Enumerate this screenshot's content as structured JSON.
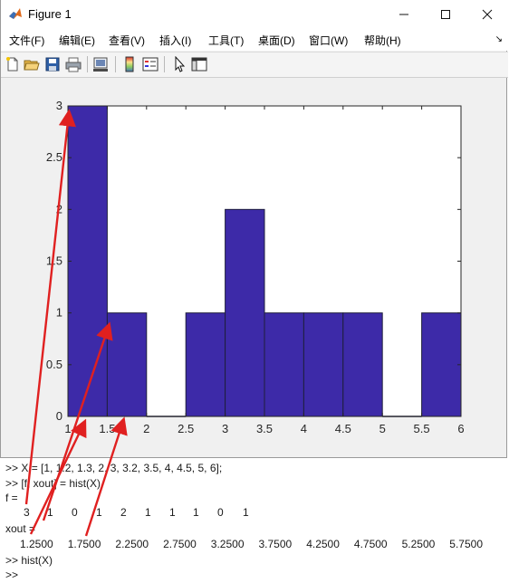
{
  "window": {
    "title": "Figure 1",
    "minimize_icon": "minimize-icon",
    "maximize_icon": "maximize-icon",
    "close_icon": "close-icon"
  },
  "menu": {
    "items": [
      "文件(F)",
      "编辑(E)",
      "查看(V)",
      "插入(I)",
      "工具(T)",
      "桌面(D)",
      "窗口(W)",
      "帮助(H)"
    ]
  },
  "toolbar": {
    "icons": [
      "new-figure-icon",
      "open-file-icon",
      "save-icon",
      "print-icon",
      "link-axes-icon",
      "colorbar-icon",
      "legend-icon",
      "pointer-icon",
      "property-editor-icon"
    ]
  },
  "chart_data": {
    "type": "bar",
    "style": "histogram",
    "bin_edges": [
      1,
      1.5,
      2,
      2.5,
      3,
      3.5,
      4,
      4.5,
      5,
      5.5,
      6
    ],
    "values": [
      3,
      1,
      0,
      1,
      2,
      1,
      1,
      1,
      0,
      1
    ],
    "xlim": [
      1,
      6
    ],
    "ylim": [
      0,
      3
    ],
    "xticks": [
      "1",
      "1.5",
      "2",
      "2.5",
      "3",
      "3.5",
      "4",
      "4.5",
      "5",
      "5.5",
      "6"
    ],
    "yticks": [
      "0",
      "0.5",
      "1",
      "1.5",
      "2",
      "2.5",
      "3"
    ],
    "bar_color": "#3d2aa8",
    "edge_color": "#1e1e3c",
    "grid": false
  },
  "console": {
    "cmd1": ">> X = [1, 1.2, 1.3, 2, 3, 3.2, 3.5, 4, 4.5, 5, 6];",
    "cmd2": ">> [f, xout] = hist(X)",
    "f_label": "f =",
    "f_values": [
      "3",
      "1",
      "0",
      "1",
      "2",
      "1",
      "1",
      "1",
      "0",
      "1"
    ],
    "xout_label": "xout =",
    "xout_values": [
      "1.2500",
      "1.7500",
      "2.2500",
      "2.7500",
      "3.2500",
      "3.7500",
      "4.2500",
      "4.7500",
      "5.2500",
      "5.7500"
    ],
    "cmd3": ">> hist(X)",
    "prompt": ">>"
  },
  "colors": {
    "annotation_arrow": "#e02020"
  }
}
